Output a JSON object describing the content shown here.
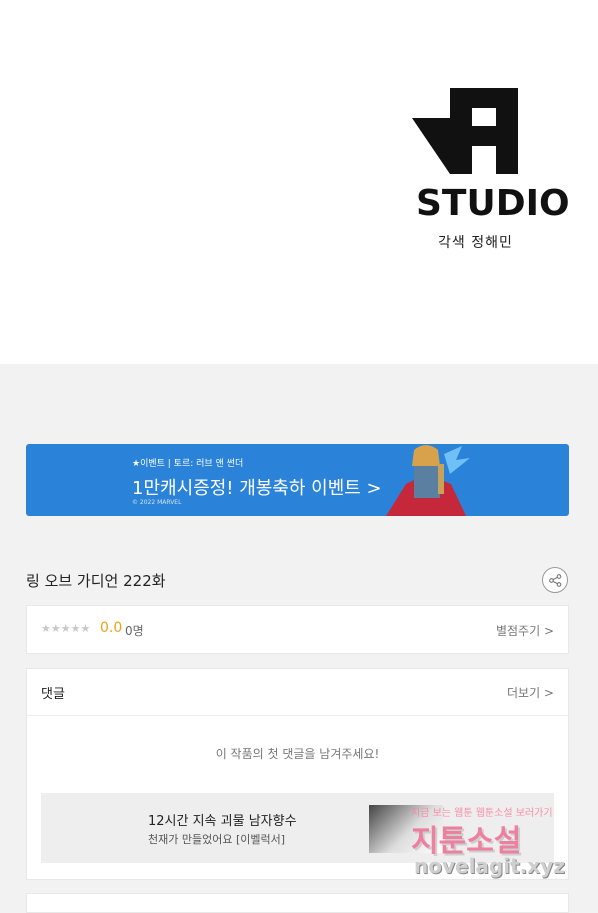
{
  "studio_logo": {
    "wordmark": "STUDIO",
    "credit": "각색 정해민"
  },
  "event_banner": {
    "subtitle": "★이벤트 | 토르: 러브 앤 썬더",
    "main": "1만캐시증정! 개봉축하 이벤트 >",
    "copyright": "© 2022 MARVEL"
  },
  "episode": {
    "title": "링 오브 가디언 222화",
    "share_icon": "share-icon"
  },
  "rating": {
    "stars": "★★★★★",
    "score": "0.0",
    "count": "0명",
    "rate_link": "별점주기 >"
  },
  "comments": {
    "title": "댓글",
    "more_link": "더보기 >",
    "empty_message": "이 작품의 첫 댓글을 남겨주세요!"
  },
  "promo": {
    "title": "12시간 지속 괴물 남자향수",
    "subtitle": "천재가 만들었어요 [이벨럭서]"
  },
  "watermark": {
    "tagline": "지금 보는 웹툰 웹툰소설 보러가기",
    "brand": "지툰소설",
    "url": "novelagit.xyz"
  },
  "colors": {
    "banner_bg": "#2a83d8",
    "score": "#e8a317",
    "page_bg": "#f2f2f2"
  }
}
